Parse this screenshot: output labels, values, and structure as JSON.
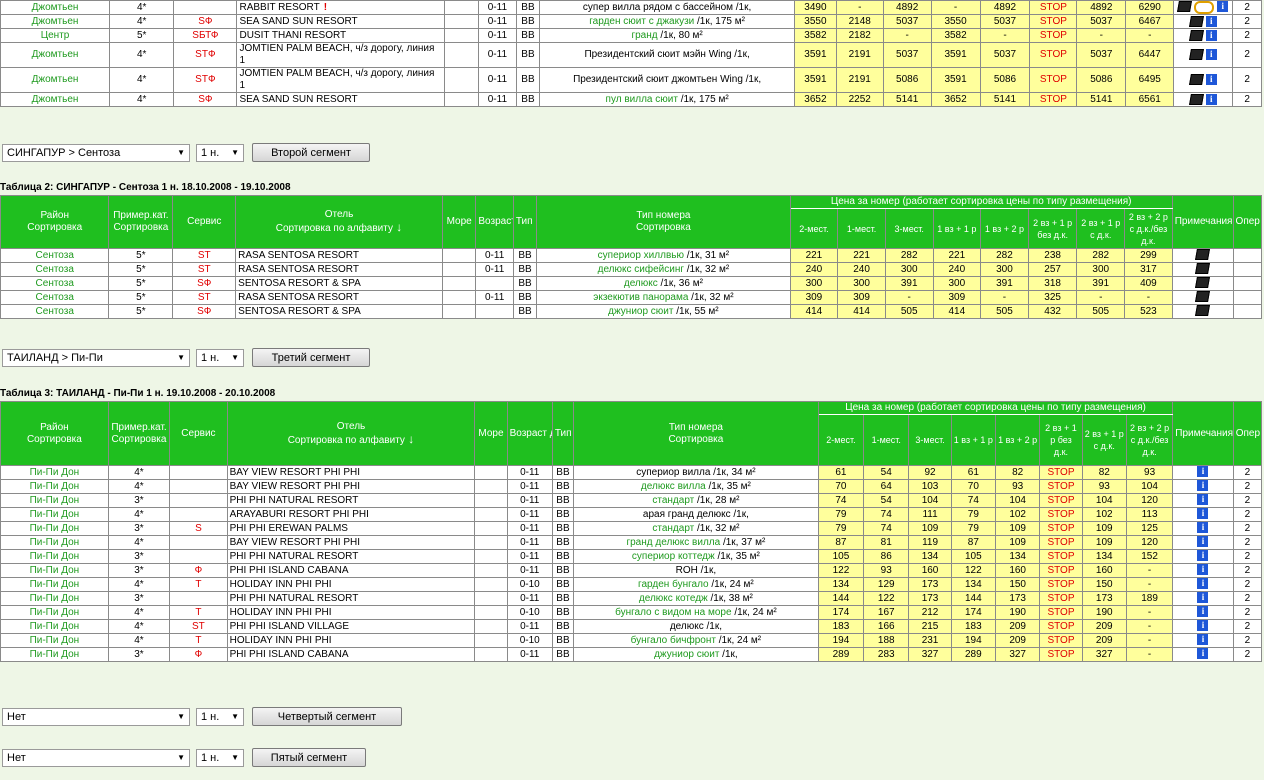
{
  "top_rows": [
    {
      "region": "Джомтьен",
      "cat": "4*",
      "svc": "",
      "hotel": "RABBIT RESORT",
      "hotel_mark": "!",
      "age": "0-11",
      "meal": "BB",
      "room_a": "",
      "room_b": "супер вилла рядом с бассейном /1к,",
      "v": [
        "3490",
        "-",
        "4892",
        "-",
        "4892",
        "STOP",
        "4892",
        "6290"
      ],
      "notes": "doc-ring-info",
      "op": "2"
    },
    {
      "region": "Джомтьен",
      "cat": "4*",
      "svc": "SФ",
      "hotel": "SEA SAND SUN RESORT",
      "hotel_mark": "",
      "age": "0-11",
      "meal": "BB",
      "room_a": "гарден сюит с джакузи",
      "room_b": " /1к, 175 м²",
      "v": [
        "3550",
        "2148",
        "5037",
        "3550",
        "5037",
        "STOP",
        "5037",
        "6467"
      ],
      "notes": "doc-info",
      "op": "2"
    },
    {
      "region": "Центр",
      "cat": "5*",
      "svc": "SБТФ",
      "hotel": "DUSIT THANI RESORT",
      "hotel_mark": "",
      "age": "0-11",
      "meal": "BB",
      "room_a": "гранд",
      "room_b": " /1к, 80 м²",
      "v": [
        "3582",
        "2182",
        "-",
        "3582",
        "-",
        "STOP",
        "-",
        "-"
      ],
      "notes": "doc-info",
      "op": "2"
    },
    {
      "region": "Джомтьен",
      "cat": "4*",
      "svc": "STФ",
      "hotel": "JOMTIEN PALM BEACH, ч/з дорогу, линия 1",
      "hotel_mark": "",
      "age": "0-11",
      "meal": "BB",
      "room_a": "",
      "room_b": "Президентский сюит мэйн Wing /1к,",
      "v": [
        "3591",
        "2191",
        "5037",
        "3591",
        "5037",
        "STOP",
        "5037",
        "6447"
      ],
      "notes": "doc-info",
      "op": "2"
    },
    {
      "region": "Джомтьен",
      "cat": "4*",
      "svc": "STФ",
      "hotel": "JOMTIEN PALM BEACH, ч/з дорогу, линия 1",
      "hotel_mark": "",
      "age": "0-11",
      "meal": "BB",
      "room_a": "",
      "room_b": "Президентский сюит джомтьен Wing /1к,",
      "v": [
        "3591",
        "2191",
        "5086",
        "3591",
        "5086",
        "STOP",
        "5086",
        "6495"
      ],
      "notes": "doc-info",
      "op": "2"
    },
    {
      "region": "Джомтьен",
      "cat": "4*",
      "svc": "SФ",
      "hotel": "SEA SAND SUN RESORT",
      "hotel_mark": "",
      "age": "0-11",
      "meal": "BB",
      "room_a": "пул вилла сюит",
      "room_b": " /1к, 175 м²",
      "v": [
        "3652",
        "2252",
        "5141",
        "3652",
        "5141",
        "STOP",
        "5141",
        "6561"
      ],
      "notes": "doc-info",
      "op": "2"
    }
  ],
  "segment2": {
    "select": "СИНГАПУР > Сентоза",
    "nights": "1 н.",
    "button": "Второй сегмент"
  },
  "segment3": {
    "select": "ТАИЛАНД > Пи-Пи",
    "nights": "1 н.",
    "button": "Третий сегмент"
  },
  "segment4": {
    "select": "Нет",
    "nights": "1 н.",
    "button": "Четвертый сегмент"
  },
  "segment5": {
    "select": "Нет",
    "nights": "1 н.",
    "button": "Пятый сегмент"
  },
  "headers": {
    "region": "Район",
    "region_sort": "Сортировка",
    "cat": "Пример.кат.",
    "cat_sort": "Сортировка",
    "svc": "Сервис",
    "hotel": "Отель",
    "hotel_sort": "Сортировка по алфавиту",
    "sea": "Море",
    "age": "Возраст детей",
    "meal": "Тип пит.",
    "room": "Тип номера",
    "room_sort": "Сортировка",
    "price": "Цена за номер (работает сортировка цены по типу размещения)",
    "cols": [
      "2-мест.",
      "1-мест.",
      "3-мест.",
      "1 вз + 1 р",
      "1 вз + 2 р",
      "2 вз + 1 р без д.к.",
      "2 вз + 1 р с д.к.",
      "2 вз + 2 р с д.к./без д.к."
    ],
    "notes": "Примечания",
    "op": "Опер"
  },
  "table2": {
    "caption": "Таблица 2: СИНГАПУР - Сентоза 1 н. 18.10.2008 - 19.10.2008",
    "rows": [
      {
        "region": "Сентоза",
        "cat": "5*",
        "svc": "ST",
        "hotel": "RASA SENTOSA RESORT",
        "age": "0-11",
        "meal": "BB",
        "room_a": "супериор хиллвью",
        "room_b": " /1к, 31 м²",
        "v": [
          "221",
          "221",
          "282",
          "221",
          "282",
          "238",
          "282",
          "299"
        ],
        "notes": "doc"
      },
      {
        "region": "Сентоза",
        "cat": "5*",
        "svc": "ST",
        "hotel": "RASA SENTOSA RESORT",
        "age": "0-11",
        "meal": "BB",
        "room_a": "делюкс сифейсинг",
        "room_b": " /1к, 32 м²",
        "v": [
          "240",
          "240",
          "300",
          "240",
          "300",
          "257",
          "300",
          "317"
        ],
        "notes": "doc"
      },
      {
        "region": "Сентоза",
        "cat": "5*",
        "svc": "SФ",
        "hotel": "SENTOSA RESORT & SPA",
        "age": "",
        "meal": "BB",
        "room_a": "делюкс",
        "room_b": " /1к, 36 м²",
        "v": [
          "300",
          "300",
          "391",
          "300",
          "391",
          "318",
          "391",
          "409"
        ],
        "notes": "doc"
      },
      {
        "region": "Сентоза",
        "cat": "5*",
        "svc": "ST",
        "hotel": "RASA SENTOSA RESORT",
        "age": "0-11",
        "meal": "BB",
        "room_a": "экзекютив панорама",
        "room_b": " /1к, 32 м²",
        "v": [
          "309",
          "309",
          "-",
          "309",
          "-",
          "325",
          "-",
          "-"
        ],
        "notes": "doc"
      },
      {
        "region": "Сентоза",
        "cat": "5*",
        "svc": "SФ",
        "hotel": "SENTOSA RESORT & SPA",
        "age": "",
        "meal": "BB",
        "room_a": "джуниор сюит",
        "room_b": " /1к, 55 м²",
        "v": [
          "414",
          "414",
          "505",
          "414",
          "505",
          "432",
          "505",
          "523"
        ],
        "notes": "doc"
      }
    ]
  },
  "table3": {
    "caption": "Таблица 3: ТАИЛАНД - Пи-Пи 1 н. 19.10.2008 - 20.10.2008",
    "rows": [
      {
        "region": "Пи-Пи Дон",
        "cat": "4*",
        "svc": "",
        "hotel": "BAY VIEW RESORT PHI PHI",
        "age": "0-11",
        "meal": "BB",
        "room_a": "",
        "room_b": "супериор вилла /1к, 34 м²",
        "v": [
          "61",
          "54",
          "92",
          "61",
          "82",
          "STOP",
          "82",
          "93"
        ],
        "op": "2"
      },
      {
        "region": "Пи-Пи Дон",
        "cat": "4*",
        "svc": "",
        "hotel": "BAY VIEW RESORT PHI PHI",
        "age": "0-11",
        "meal": "BB",
        "room_a": "делюкс вилла",
        "room_b": " /1к, 35 м²",
        "v": [
          "70",
          "64",
          "103",
          "70",
          "93",
          "STOP",
          "93",
          "104"
        ],
        "op": "2"
      },
      {
        "region": "Пи-Пи Дон",
        "cat": "3*",
        "svc": "",
        "hotel": "PHI PHI NATURAL RESORT",
        "age": "0-11",
        "meal": "BB",
        "room_a": "стандарт",
        "room_b": " /1к, 28 м²",
        "v": [
          "74",
          "54",
          "104",
          "74",
          "104",
          "STOP",
          "104",
          "120"
        ],
        "op": "2"
      },
      {
        "region": "Пи-Пи Дон",
        "cat": "4*",
        "svc": "",
        "hotel": "ARAYABURI RESORT PHI PHI",
        "age": "0-11",
        "meal": "BB",
        "room_a": "",
        "room_b": "арая гранд делюкс /1к,",
        "v": [
          "79",
          "74",
          "111",
          "79",
          "102",
          "STOP",
          "102",
          "113"
        ],
        "op": "2"
      },
      {
        "region": "Пи-Пи Дон",
        "cat": "3*",
        "svc": "S",
        "hotel": "PHI PHI EREWAN PALMS",
        "age": "0-11",
        "meal": "BB",
        "room_a": "стандарт",
        "room_b": " /1к, 32 м²",
        "v": [
          "79",
          "74",
          "109",
          "79",
          "109",
          "STOP",
          "109",
          "125"
        ],
        "op": "2"
      },
      {
        "region": "Пи-Пи Дон",
        "cat": "4*",
        "svc": "",
        "hotel": "BAY VIEW RESORT PHI PHI",
        "age": "0-11",
        "meal": "BB",
        "room_a": "гранд делюкс вилла",
        "room_b": " /1к, 37 м²",
        "v": [
          "87",
          "81",
          "119",
          "87",
          "109",
          "STOP",
          "109",
          "120"
        ],
        "op": "2"
      },
      {
        "region": "Пи-Пи Дон",
        "cat": "3*",
        "svc": "",
        "hotel": "PHI PHI NATURAL RESORT",
        "age": "0-11",
        "meal": "BB",
        "room_a": "супериор коттедж",
        "room_b": " /1к, 35 м²",
        "v": [
          "105",
          "86",
          "134",
          "105",
          "134",
          "STOP",
          "134",
          "152"
        ],
        "op": "2"
      },
      {
        "region": "Пи-Пи Дон",
        "cat": "3*",
        "svc": "Ф",
        "hotel": "PHI PHI ISLAND CABANA",
        "age": "0-11",
        "meal": "BB",
        "room_a": "",
        "room_b": "ROH /1к,",
        "v": [
          "122",
          "93",
          "160",
          "122",
          "160",
          "STOP",
          "160",
          "-"
        ],
        "op": "2"
      },
      {
        "region": "Пи-Пи Дон",
        "cat": "4*",
        "svc": "T",
        "hotel": "HOLIDAY INN PHI PHI",
        "age": "0-10",
        "meal": "BB",
        "room_a": "гарден бунгало",
        "room_b": " /1к, 24 м²",
        "v": [
          "134",
          "129",
          "173",
          "134",
          "150",
          "STOP",
          "150",
          "-"
        ],
        "op": "2"
      },
      {
        "region": "Пи-Пи Дон",
        "cat": "3*",
        "svc": "",
        "hotel": "PHI PHI NATURAL RESORT",
        "age": "0-11",
        "meal": "BB",
        "room_a": "делюкс котедж",
        "room_b": " /1к, 38 м²",
        "v": [
          "144",
          "122",
          "173",
          "144",
          "173",
          "STOP",
          "173",
          "189"
        ],
        "op": "2"
      },
      {
        "region": "Пи-Пи Дон",
        "cat": "4*",
        "svc": "T",
        "hotel": "HOLIDAY INN PHI PHI",
        "age": "0-10",
        "meal": "BB",
        "room_a": "бунгало с видом на море",
        "room_b": " /1к, 24 м²",
        "v": [
          "174",
          "167",
          "212",
          "174",
          "190",
          "STOP",
          "190",
          "-"
        ],
        "op": "2"
      },
      {
        "region": "Пи-Пи Дон",
        "cat": "4*",
        "svc": "ST",
        "hotel": "PHI PHI ISLAND VILLAGE",
        "age": "0-11",
        "meal": "BB",
        "room_a": "",
        "room_b": "делюкс /1к,",
        "v": [
          "183",
          "166",
          "215",
          "183",
          "209",
          "STOP",
          "209",
          "-"
        ],
        "op": "2"
      },
      {
        "region": "Пи-Пи Дон",
        "cat": "4*",
        "svc": "T",
        "hotel": "HOLIDAY INN PHI PHI",
        "age": "0-10",
        "meal": "BB",
        "room_a": "бунгало бичфронт",
        "room_b": " /1к, 24 м²",
        "v": [
          "194",
          "188",
          "231",
          "194",
          "209",
          "STOP",
          "209",
          "-"
        ],
        "op": "2"
      },
      {
        "region": "Пи-Пи Дон",
        "cat": "3*",
        "svc": "Ф",
        "hotel": "PHI PHI ISLAND CABANA",
        "age": "0-11",
        "meal": "BB",
        "room_a": "джуниор сюит",
        "room_b": " /1к,",
        "v": [
          "289",
          "283",
          "327",
          "289",
          "327",
          "STOP",
          "327",
          "-"
        ],
        "op": "2"
      }
    ]
  }
}
